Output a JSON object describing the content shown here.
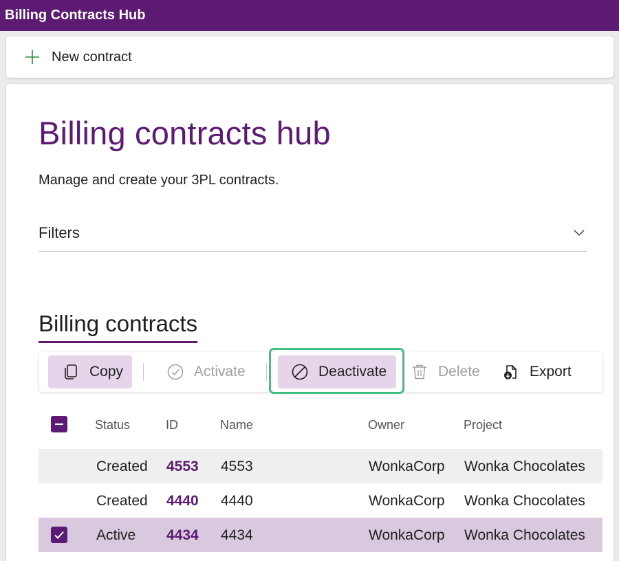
{
  "app": {
    "title": "Billing Contracts Hub"
  },
  "command_bar": {
    "new_contract_label": "New contract"
  },
  "page": {
    "title": "Billing contracts hub",
    "subtitle": "Manage and create your 3PL contracts.",
    "filters_label": "Filters"
  },
  "section": {
    "title": "Billing contracts"
  },
  "toolbar": {
    "copy_label": "Copy",
    "activate_label": "Activate",
    "deactivate_label": "Deactivate",
    "delete_label": "Delete",
    "export_label": "Export"
  },
  "grid": {
    "columns": {
      "status": "Status",
      "id": "ID",
      "name": "Name",
      "owner": "Owner",
      "project": "Project"
    },
    "rows": [
      {
        "status": "Created",
        "id": "4553",
        "name": "4553",
        "owner": "WonkaCorp",
        "project": "Wonka Chocolates",
        "selected": false
      },
      {
        "status": "Created",
        "id": "4440",
        "name": "4440",
        "owner": "WonkaCorp",
        "project": "Wonka Chocolates",
        "selected": false
      },
      {
        "status": "Active",
        "id": "4434",
        "name": "4434",
        "owner": "WonkaCorp",
        "project": "Wonka Chocolates",
        "selected": true
      }
    ]
  },
  "colors": {
    "brand": "#5c1a73",
    "focus": "#3fbf86",
    "selected_row": "#d9c9de",
    "selected_button": "#e6d5ea"
  },
  "icons": {
    "new": "plus-icon",
    "filters_toggle": "chevron-down-icon",
    "copy": "copy-icon",
    "activate": "check-circle-icon",
    "deactivate": "prohibited-icon",
    "delete": "trash-icon",
    "export": "export-icon"
  }
}
